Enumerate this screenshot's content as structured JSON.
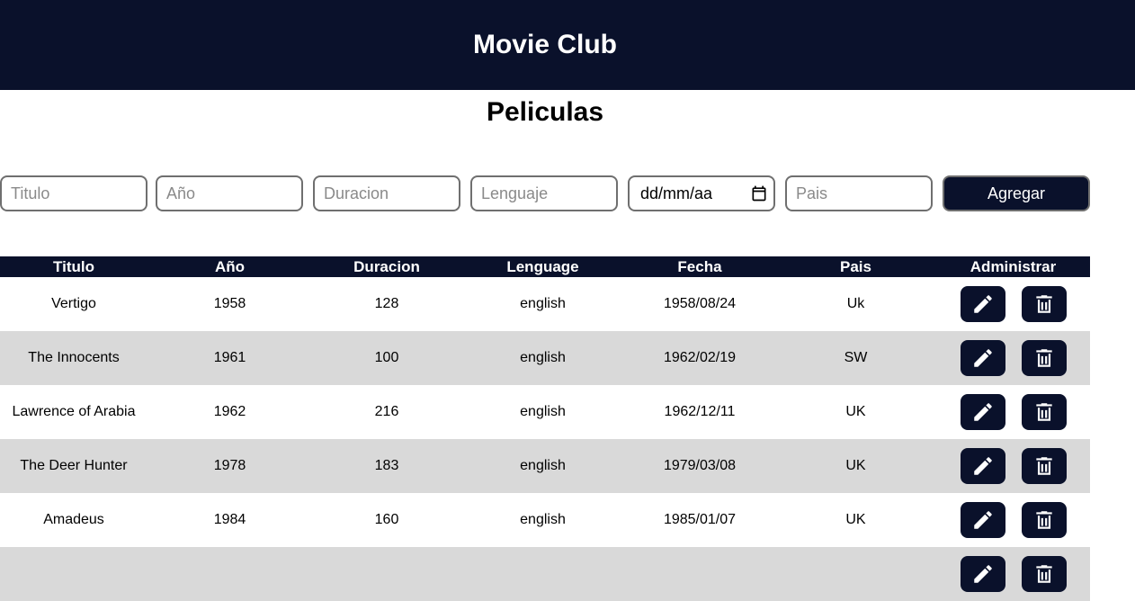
{
  "header": {
    "title": "Movie Club"
  },
  "page": {
    "heading": "Peliculas"
  },
  "form": {
    "titulo_placeholder": "Titulo",
    "anio_placeholder": "Año",
    "duracion_placeholder": "Duracion",
    "lenguaje_placeholder": "Lenguaje",
    "fecha_value": "dd/mm/aa",
    "pais_placeholder": "Pais",
    "add_label": "Agregar"
  },
  "table": {
    "headers": [
      "Titulo",
      "Año",
      "Duracion",
      "Lenguage",
      "Fecha",
      "Pais",
      "Administrar"
    ],
    "rows": [
      [
        "Vertigo",
        "1958",
        "128",
        "english",
        "1958/08/24",
        "Uk"
      ],
      [
        "The Innocents",
        "1961",
        "100",
        "english",
        "1962/02/19",
        "SW"
      ],
      [
        "Lawrence of Arabia",
        "1962",
        "216",
        "english",
        "1962/12/11",
        "UK"
      ],
      [
        "The Deer Hunter",
        "1978",
        "183",
        "english",
        "1979/03/08",
        "UK"
      ],
      [
        "Amadeus",
        "1984",
        "160",
        "english",
        "1985/01/07",
        "UK"
      ],
      [
        "",
        "",
        "",
        "",
        "",
        ""
      ]
    ]
  },
  "colors": {
    "navy": "#0a112b",
    "row_alt": "#d9d9d9",
    "border": "#6f6f6f"
  },
  "icons": {
    "edit": "pencil-icon",
    "delete": "trash-icon",
    "date": "calendar-icon"
  }
}
